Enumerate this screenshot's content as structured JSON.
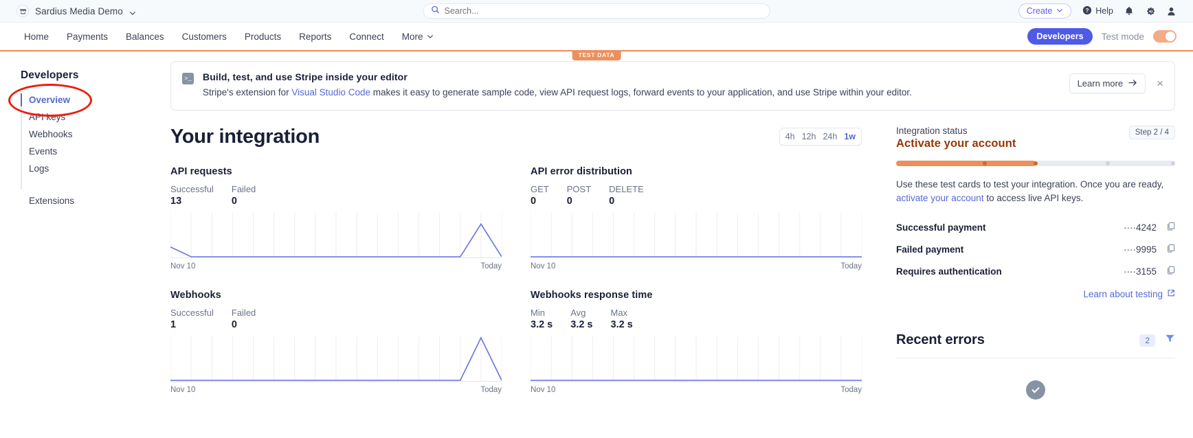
{
  "topbar": {
    "account_name": "Sardius Media Demo",
    "account_icon": "store-icon",
    "search_placeholder": "Search...",
    "create_label": "Create",
    "help_label": "Help"
  },
  "nav": {
    "items": [
      {
        "label": "Home"
      },
      {
        "label": "Payments"
      },
      {
        "label": "Balances"
      },
      {
        "label": "Customers"
      },
      {
        "label": "Products"
      },
      {
        "label": "Reports"
      },
      {
        "label": "Connect"
      },
      {
        "label": "More"
      }
    ],
    "developers_label": "Developers",
    "test_mode_label": "Test mode",
    "test_data_label": "TEST DATA"
  },
  "sidebar": {
    "title": "Developers",
    "items": [
      {
        "label": "Overview",
        "active": true
      },
      {
        "label": "API keys",
        "active": false
      },
      {
        "label": "Webhooks",
        "active": false
      },
      {
        "label": "Events",
        "active": false
      },
      {
        "label": "Logs",
        "active": false
      },
      {
        "label": "Extensions",
        "active": false
      }
    ]
  },
  "banner": {
    "icon": "terminal-icon",
    "title": "Build, test, and use Stripe inside your editor",
    "body_prefix": "Stripe's extension for ",
    "body_link": "Visual Studio Code",
    "body_suffix": " makes it easy to generate sample code, view API request logs, forward events to your application, and use Stripe within your editor.",
    "learn_more_label": "Learn more",
    "close_label": "×"
  },
  "integration": {
    "title": "Your integration",
    "ranges": [
      {
        "label": "4h",
        "active": false
      },
      {
        "label": "12h",
        "active": false
      },
      {
        "label": "24h",
        "active": false
      },
      {
        "label": "1w",
        "active": true
      }
    ]
  },
  "chart_data": [
    {
      "type": "line",
      "title": "API requests",
      "metrics": [
        {
          "label": "Successful",
          "value": "13"
        },
        {
          "label": "Failed",
          "value": "0"
        }
      ],
      "xlabel_start": "Nov 10",
      "xlabel_end": "Today",
      "x": [
        0,
        1,
        2,
        3,
        4,
        5,
        6,
        7,
        8,
        9,
        10,
        11,
        12,
        13,
        14,
        15,
        16
      ],
      "values": [
        3,
        0,
        0,
        0,
        0,
        0,
        0,
        0,
        0,
        0,
        0,
        0,
        0,
        0,
        0,
        10,
        0
      ],
      "ylim": [
        0,
        13
      ],
      "grid": true,
      "series_color": "#6772e5"
    },
    {
      "type": "line",
      "title": "API error distribution",
      "metrics": [
        {
          "label": "GET",
          "value": "0"
        },
        {
          "label": "POST",
          "value": "0"
        },
        {
          "label": "DELETE",
          "value": "0"
        }
      ],
      "xlabel_start": "Nov 10",
      "xlabel_end": "Today",
      "x": [
        0,
        1,
        2,
        3,
        4,
        5,
        6,
        7,
        8,
        9,
        10,
        11,
        12,
        13,
        14,
        15,
        16
      ],
      "values": [
        0,
        0,
        0,
        0,
        0,
        0,
        0,
        0,
        0,
        0,
        0,
        0,
        0,
        0,
        0,
        0,
        0
      ],
      "ylim": [
        0,
        1
      ],
      "grid": true,
      "series_color": "#6772e5"
    },
    {
      "type": "line",
      "title": "Webhooks",
      "metrics": [
        {
          "label": "Successful",
          "value": "1"
        },
        {
          "label": "Failed",
          "value": "0"
        }
      ],
      "xlabel_start": "Nov 10",
      "xlabel_end": "Today",
      "x": [
        0,
        1,
        2,
        3,
        4,
        5,
        6,
        7,
        8,
        9,
        10,
        11,
        12,
        13,
        14,
        15,
        16
      ],
      "values": [
        0,
        0,
        0,
        0,
        0,
        0,
        0,
        0,
        0,
        0,
        0,
        0,
        0,
        0,
        0,
        1,
        0
      ],
      "ylim": [
        0,
        1
      ],
      "grid": true,
      "series_color": "#6772e5"
    },
    {
      "type": "line",
      "title": "Webhooks response time",
      "metrics": [
        {
          "label": "Min",
          "value": "3.2 s"
        },
        {
          "label": "Avg",
          "value": "3.2 s"
        },
        {
          "label": "Max",
          "value": "3.2 s"
        }
      ],
      "xlabel_start": "Nov 10",
      "xlabel_end": "Today",
      "x": [
        0,
        1,
        2,
        3,
        4,
        5,
        6,
        7,
        8,
        9,
        10,
        11,
        12,
        13,
        14,
        15,
        16
      ],
      "values": [
        0,
        0,
        0,
        0,
        0,
        0,
        0,
        0,
        0,
        0,
        0,
        0,
        0,
        0,
        0,
        0,
        0
      ],
      "ylim": [
        0,
        4
      ],
      "grid": true,
      "series_color": "#6772e5"
    }
  ],
  "status_panel": {
    "label": "Integration status",
    "headline": "Activate your account",
    "step_badge": "Step 2 / 4",
    "progress_percent": 50,
    "description_prefix": "Use these test cards to test your integration. Once you are ready, ",
    "description_link": "activate your account",
    "description_suffix": " to access live API keys.",
    "cards": [
      {
        "name": "Successful payment",
        "number": "····4242"
      },
      {
        "name": "Failed payment",
        "number": "····9995"
      },
      {
        "name": "Requires authentication",
        "number": "····3155"
      }
    ],
    "learn_testing_label": "Learn about testing"
  },
  "recent_errors": {
    "title": "Recent errors",
    "count": "2",
    "empty_icon": "check-circle-icon"
  },
  "colors": {
    "brand_purple": "#5469d4",
    "dev_pill": "#4f5ae8",
    "test_orange": "#ed8f5b",
    "activate_red": "#983705",
    "chart_line": "#6772e5"
  }
}
